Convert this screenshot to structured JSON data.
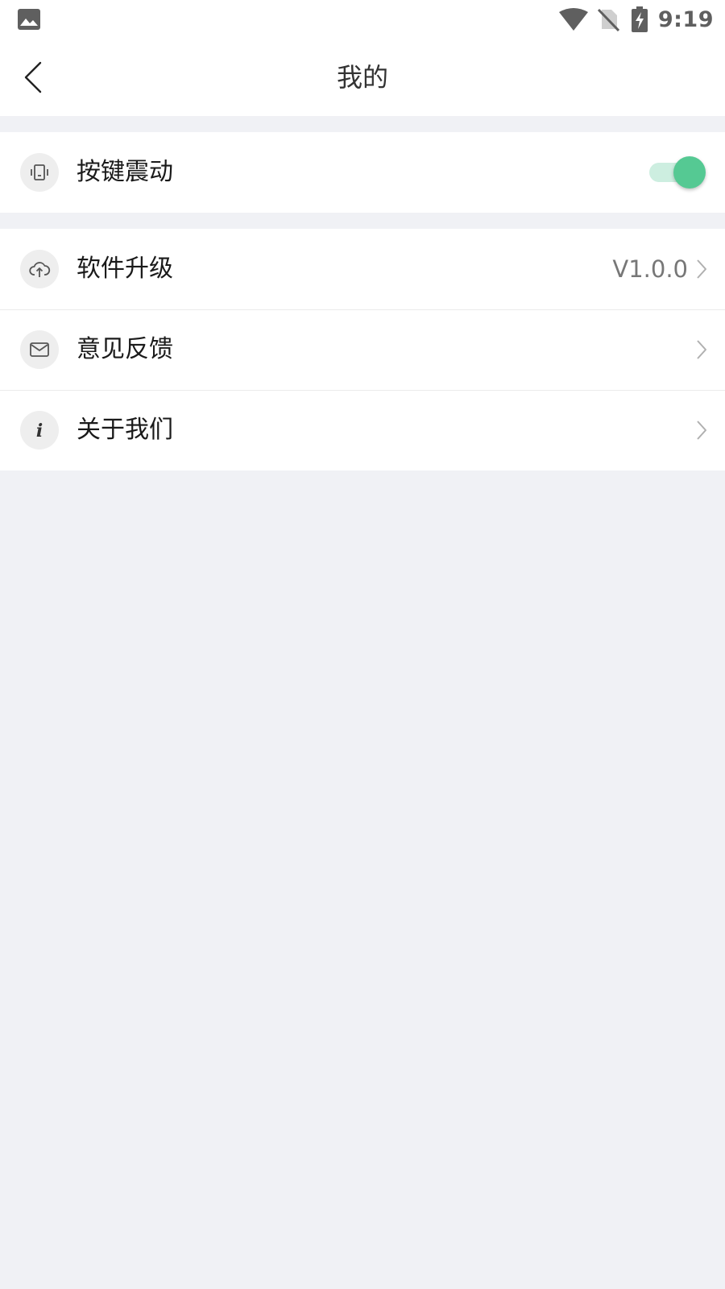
{
  "status_bar": {
    "time": "9:19",
    "icons": [
      "photo-icon",
      "wifi-icon",
      "no-sim-icon",
      "battery-charging-icon"
    ]
  },
  "header": {
    "title": "我的",
    "back_icon": "back-arrow-icon"
  },
  "settings": {
    "vibration": {
      "label": "按键震动",
      "icon": "vibration-icon",
      "enabled": true,
      "accent_color": "#55c993"
    },
    "items": [
      {
        "label": "软件升级",
        "icon": "cloud-upload-icon",
        "value": "V1.0.0"
      },
      {
        "label": "意见反馈",
        "icon": "mail-icon",
        "value": ""
      },
      {
        "label": "关于我们",
        "icon": "info-icon",
        "value": ""
      }
    ]
  },
  "colors": {
    "background": "#f0f1f5",
    "surface": "#ffffff",
    "toggle_on": "#55c993"
  }
}
